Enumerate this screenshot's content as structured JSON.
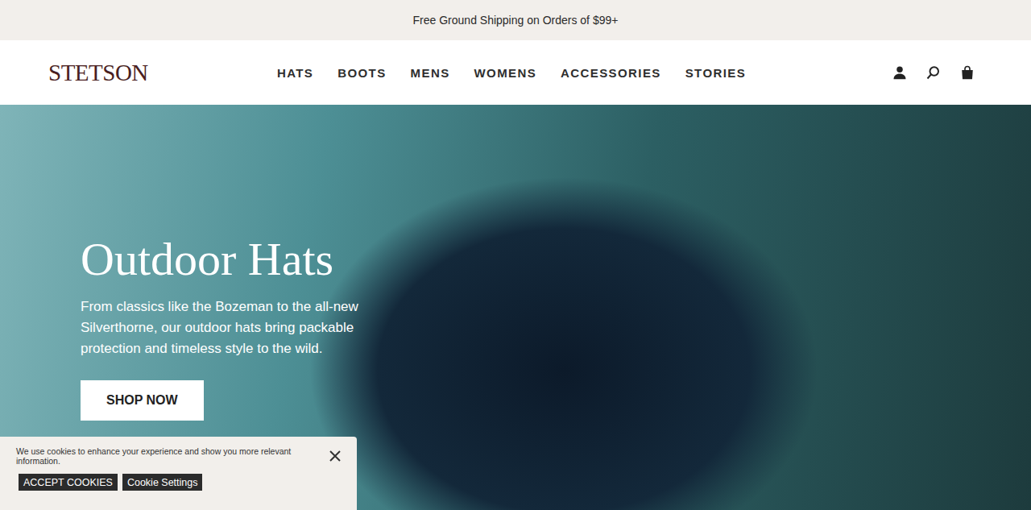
{
  "banner": {
    "text": "Free Ground Shipping on Orders of $99+"
  },
  "header": {
    "logo": "STETSON",
    "nav": [
      "HATS",
      "BOOTS",
      "MENS",
      "WOMENS",
      "ACCESSORIES",
      "STORIES"
    ]
  },
  "hero": {
    "title": "Outdoor Hats",
    "body": "From classics like the Bozeman to the all-new Silverthorne, our outdoor hats bring packable protection and timeless style to the wild.",
    "button": "SHOP NOW"
  },
  "cookie": {
    "message": "We use cookies to enhance your experience and show you more relevant information.",
    "buttons": [
      "ACCEPT COOKIES",
      "Cookie Settings"
    ]
  }
}
